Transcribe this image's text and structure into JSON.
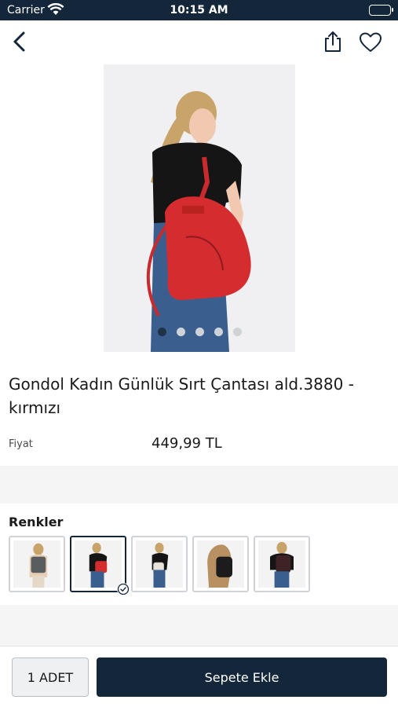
{
  "status_bar": {
    "carrier": "Carrier",
    "time": "10:15 AM"
  },
  "product": {
    "title": "Gondol Kadın Günlük Sırt Çantası ald.3880 - kırmızı",
    "price_label": "Fiyat",
    "price": "449,99 TL",
    "image_carousel": {
      "count": 5,
      "active_index": 0
    }
  },
  "colors": {
    "label": "Renkler",
    "options": [
      {
        "name": "gri",
        "bag_color": "#5a5d60",
        "selected": false
      },
      {
        "name": "kırmızı",
        "bag_color": "#d52c30",
        "selected": true
      },
      {
        "name": "bej",
        "bag_color": "#e9e4da",
        "selected": false
      },
      {
        "name": "siyah",
        "bag_color": "#1c1c1c",
        "selected": false
      },
      {
        "name": "bordo",
        "bag_color": "#3d2226",
        "selected": false
      }
    ]
  },
  "actions": {
    "quantity": "1 ADET",
    "add_to_cart": "Sepete Ekle"
  },
  "theme": {
    "primary": "#13263a",
    "accent_bag": "#d52c30"
  }
}
